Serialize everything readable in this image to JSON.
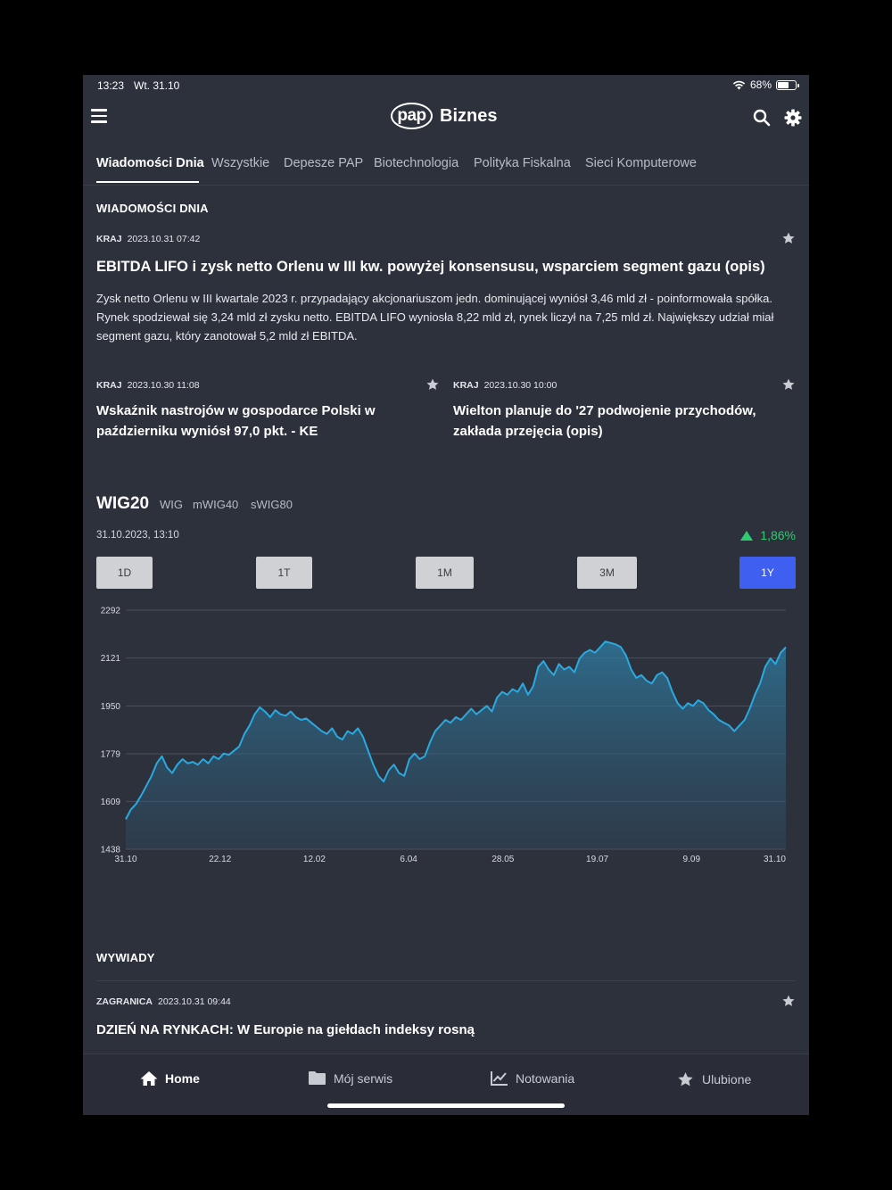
{
  "status": {
    "time": "13:23",
    "date": "Wt. 31.10",
    "battery": "68%",
    "battery_level": 0.68
  },
  "header": {
    "logo_mark": "pap",
    "logo_text": "Biznes"
  },
  "tabs": [
    "Wiadomości Dnia",
    "Wszystkie",
    "Depesze PAP",
    "Biotechnologia",
    "Polityka Fiskalna",
    "Sieci Komputerowe"
  ],
  "news": {
    "section_title": "WIADOMOŚCI DNIA",
    "featured": {
      "category": "KRAJ",
      "datetime": "2023.10.31 07:42",
      "title": "EBITDA LIFO i zysk netto Orlenu w III kw. powyżej konsensusu, wsparciem segment gazu (opis)",
      "lead": "Zysk netto Orlenu w III kwartale 2023 r. przypadający akcjonariuszom jedn. dominującej wyniósł 3,46 mld zł - poinformowała spółka. Rynek spodziewał się 3,24 mld zł zysku netto. EBITDA LIFO wyniosła 8,22 mld zł, rynek liczył na 7,25 mld zł. Największy udział miał segment gazu, który zanotował 5,2 mld zł EBITDA."
    },
    "items": [
      {
        "category": "KRAJ",
        "datetime": "2023.10.30 11:08",
        "title": "Wskaźnik nastrojów w gospodarce Polski w październiku wyniósł 97,0 pkt. - KE"
      },
      {
        "category": "KRAJ",
        "datetime": "2023.10.30 10:00",
        "title": "Wielton planuje do '27 podwojenie przychodów, zakłada przejęcia (opis)"
      }
    ]
  },
  "index": {
    "selected": "WIG20",
    "others": [
      "WIG",
      "mWIG40",
      "sWIG80"
    ],
    "datetime": "31.10.2023, 13:10",
    "change": "1,86%",
    "change_color": "#2ecc71",
    "ranges": [
      "1D",
      "1T",
      "1M",
      "3M",
      "1Y"
    ],
    "active_range": "1Y"
  },
  "chart_data": {
    "type": "area",
    "title": "",
    "xlabel": "",
    "ylabel": "",
    "y_ticks": [
      1438,
      1609,
      1779,
      1950,
      2121,
      2292
    ],
    "ylim": [
      1438,
      2292
    ],
    "x_ticks": [
      "31.10",
      "22.12",
      "12.02",
      "6.04",
      "28.05",
      "19.07",
      "9.09",
      "31.10"
    ],
    "grid": true,
    "line_color": "#2aa9e0",
    "values": [
      1545,
      1580,
      1600,
      1630,
      1665,
      1700,
      1745,
      1770,
      1730,
      1710,
      1740,
      1760,
      1745,
      1750,
      1740,
      1760,
      1745,
      1770,
      1760,
      1780,
      1775,
      1790,
      1805,
      1850,
      1880,
      1920,
      1945,
      1930,
      1910,
      1935,
      1920,
      1915,
      1930,
      1910,
      1900,
      1905,
      1890,
      1875,
      1860,
      1850,
      1870,
      1840,
      1830,
      1860,
      1850,
      1870,
      1840,
      1790,
      1740,
      1700,
      1680,
      1720,
      1740,
      1710,
      1700,
      1760,
      1780,
      1760,
      1770,
      1820,
      1860,
      1880,
      1900,
      1890,
      1910,
      1900,
      1920,
      1940,
      1920,
      1935,
      1950,
      1930,
      1980,
      2000,
      1990,
      2010,
      2000,
      2030,
      1990,
      2020,
      2090,
      2110,
      2080,
      2060,
      2100,
      2080,
      2090,
      2070,
      2120,
      2140,
      2150,
      2140,
      2160,
      2180,
      2175,
      2170,
      2160,
      2130,
      2080,
      2050,
      2060,
      2040,
      2030,
      2060,
      2070,
      2050,
      2000,
      1960,
      1940,
      1960,
      1950,
      1970,
      1960,
      1935,
      1920,
      1900,
      1890,
      1880,
      1860,
      1880,
      1900,
      1940,
      1990,
      2030,
      2090,
      2120,
      2100,
      2140,
      2160
    ]
  },
  "interviews": {
    "section_title": "WYWIADY",
    "items": [
      {
        "category": "ZAGRANICA",
        "datetime": "2023.10.31 09:44",
        "title": "DZIEŃ NA RYNKACH: W Europie na giełdach indeksy rosną"
      }
    ]
  },
  "bottom_nav": [
    {
      "label": "Home",
      "icon": "home-icon"
    },
    {
      "label": "Mój serwis",
      "icon": "folder-icon"
    },
    {
      "label": "Notowania",
      "icon": "chart-line-icon"
    },
    {
      "label": "Ulubione",
      "icon": "star-icon"
    }
  ],
  "colors": {
    "background": "#2d313c",
    "accent": "#3f5ff0",
    "positive": "#2ecc71"
  }
}
